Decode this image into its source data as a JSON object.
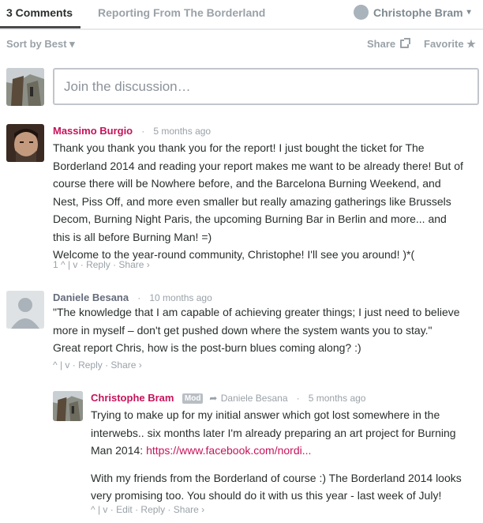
{
  "nav": {
    "comments_tab": "3 Comments",
    "forum_tab": "Reporting From The Borderland",
    "user_name": "Christophe Bram",
    "user_caret": "▾"
  },
  "toolbar": {
    "sort": "Sort by Best ▾",
    "share": "Share",
    "favorite": "Favorite ★"
  },
  "composer": {
    "placeholder": "Join the discussion…"
  },
  "comments": [
    {
      "author": "Massimo Burgio",
      "time": "5 months ago",
      "lines": [
        "Thank you thank you thank you for the report! I just bought the ticket for The",
        "Borderland 2014 and reading your report makes me want to be already there! But of",
        "course there will be Nowhere before, and the Barcelona Burning Weekend, and",
        "Nest, Piss Off, and more even smaller but really amazing gatherings like Brussels",
        "Decom, Burning Night Paris, the upcoming Burning Bar in Berlin and more... and",
        "this is all before Burning Man! =)",
        "Welcome to the year-round community, Christophe! I'll see you around! )*("
      ],
      "actions": "1 ^ | v · Reply · Share ›"
    },
    {
      "author": "Daniele Besana",
      "time": "10 months ago",
      "lines": [
        "\"The knowledge that I am capable of achieving greater things; I just need to believe",
        "more in myself – don't get pushed down where the system wants you to stay.\"",
        "Great report Chris, how is the post-burn blues coming along? :)"
      ],
      "actions": "^ | v · Reply · Share ›"
    },
    {
      "author": "Christophe Bram",
      "badge": "Mod",
      "reply_to": "Daniele Besana",
      "time": "5 months ago",
      "lines": [
        "Trying to make up for my initial answer which got lost somewhere in the",
        "interwebs.. six months later I'm already preparing an art project for Burning",
        "Man 2014:"
      ],
      "link": "https://www.facebook.com/nordi...",
      "lines2": [
        "With my friends from the Borderland of course :) The Borderland 2014 looks",
        "very promising too. You should do it with us this year - last week of July!"
      ],
      "actions": "^ | v · Edit · Reply · Share ›"
    }
  ]
}
